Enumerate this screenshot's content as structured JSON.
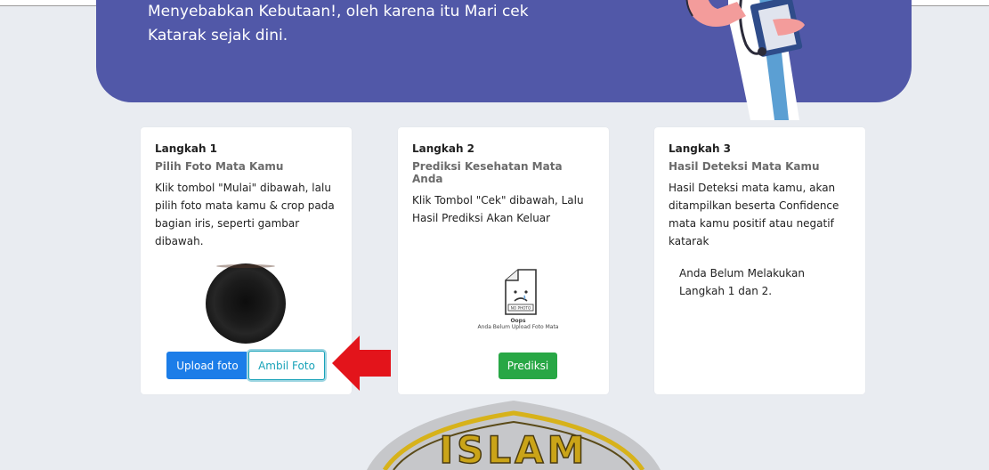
{
  "hero": {
    "line1": "Menyebabkan Kebutaan!, oleh karena itu Mari cek",
    "line2": "Katarak sejak dini."
  },
  "cards": [
    {
      "step": "Langkah 1",
      "title": "Pilih Foto Mata Kamu",
      "description": "Klik tombol \"Mulai\" dibawah, lalu pilih foto mata kamu & crop pada bagian iris, seperti gambar dibawah.",
      "buttons": {
        "upload": "Upload foto",
        "camera": "Ambil Foto"
      }
    },
    {
      "step": "Langkah 2",
      "title": "Prediksi Kesehatan Mata Anda",
      "description": "Klik Tombol \"Cek\" dibawah, Lalu Hasil Prediksi Akan Keluar",
      "placeholder": {
        "label": "NO PHOTO",
        "title": "Oops",
        "message": "Anda Belum Upload Foto Mata"
      },
      "buttons": {
        "predict": "Prediksi"
      }
    },
    {
      "step": "Langkah 3",
      "title": "Hasil Deteksi Mata Kamu",
      "description": "Hasil Deteksi mata kamu, akan ditampilkan beserta Confidence mata kamu positif atau negatif katarak",
      "status": "Anda Belum Melakukan Langkah 1 dan 2."
    }
  ],
  "watermark": {
    "text": "ISLAM"
  },
  "colors": {
    "hero": "#5158a8",
    "upload": "#1c7de8",
    "camera": "#17a2b8",
    "predict": "#28a745",
    "arrow": "#e3141b"
  },
  "icons": {
    "arrow": "red-arrow-icon",
    "doctor": "doctor-illustration",
    "photo": "no-photo-icon"
  }
}
